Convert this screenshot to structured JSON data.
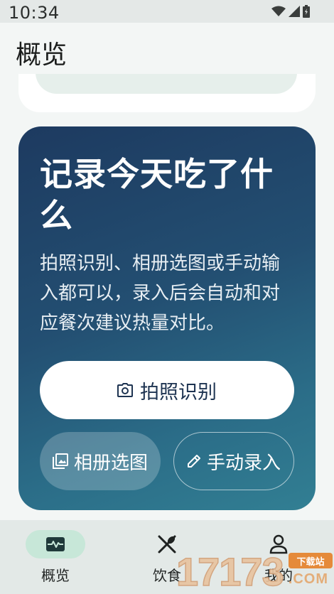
{
  "status_bar": {
    "time": "10:34",
    "icons": [
      "wifi-icon",
      "signal-icon",
      "battery-icon"
    ]
  },
  "header": {
    "title": "概览"
  },
  "hero": {
    "title": "记录今天吃了什么",
    "description": "拍照识别、相册选图或手动输入都可以，录入后会自动和对应餐次建议热量对比。",
    "photo_button": "拍照识别",
    "album_button": "相册选图",
    "manual_button": "手动录入",
    "gradient": [
      "#1d3a60",
      "#327f93"
    ]
  },
  "bottom_nav": {
    "items": [
      {
        "label": "概览",
        "icon": "pulse-icon",
        "active": true
      },
      {
        "label": "饮食",
        "icon": "utensils-icon",
        "active": false
      },
      {
        "label": "我的",
        "icon": "person-icon",
        "active": false
      }
    ],
    "active_color": "#c7e7d8"
  },
  "watermark": {
    "number": "17173",
    "badge": "下载站",
    "suffix": ".COM"
  }
}
